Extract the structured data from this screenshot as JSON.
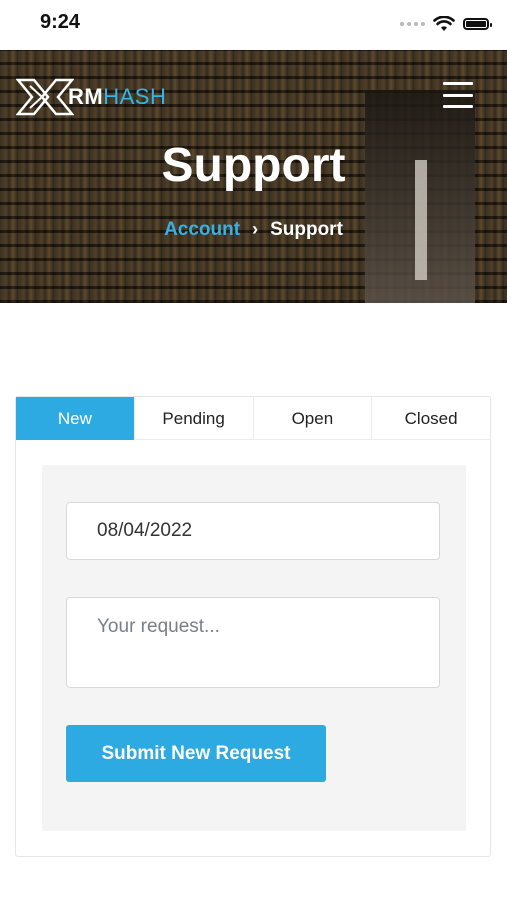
{
  "status_bar": {
    "time": "9:24",
    "icons": [
      "signal-icon",
      "wifi-icon",
      "battery-icon"
    ]
  },
  "header": {
    "logo_part_a": "RM",
    "logo_part_b": "HASH",
    "menu_icon": "hamburger-menu-icon",
    "title": "Support",
    "breadcrumb": {
      "link": "Account",
      "separator": "›",
      "current": "Support"
    }
  },
  "tabs": [
    {
      "label": "New",
      "active": true
    },
    {
      "label": "Pending",
      "active": false
    },
    {
      "label": "Open",
      "active": false
    },
    {
      "label": "Closed",
      "active": false
    }
  ],
  "form": {
    "date_value": "08/04/2022",
    "request_placeholder": "Your request...",
    "submit_label": "Submit New Request"
  },
  "colors": {
    "accent": "#2eaae2",
    "link": "#36b1e6",
    "panel_bg": "#f4f4f4"
  }
}
